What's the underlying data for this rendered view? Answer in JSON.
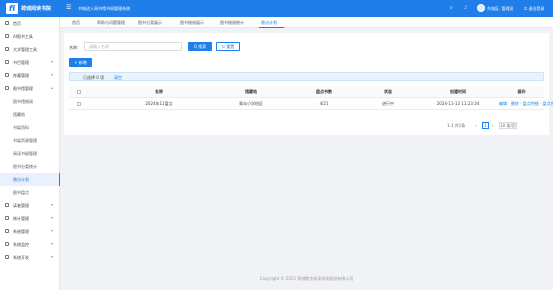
{
  "header": {
    "logo_text": "fi",
    "brand": "荷城阅读书院",
    "system_title": "书城进入网书馆书网管理系统",
    "username": "东城区. 管理员",
    "logout": "退出登录"
  },
  "tabs": [
    {
      "label": "首页"
    },
    {
      "label": "帮助与问题管理"
    },
    {
      "label": "图书分类展示"
    },
    {
      "label": "图书借阅展示"
    },
    {
      "label": "图书借阅统计"
    },
    {
      "label": "邀访计划"
    }
  ],
  "sidebar": {
    "items": [
      {
        "label": "首页",
        "icon": "home-icon"
      },
      {
        "label": "AI图书工具",
        "icon": "ai-icon"
      },
      {
        "label": "大学管理工具",
        "icon": "school-icon"
      },
      {
        "label": "书目管理",
        "icon": "book-icon",
        "chevron": "▾"
      },
      {
        "label": "库藏管理",
        "icon": "storage-icon",
        "chevron": "▾"
      },
      {
        "label": "图书馆管理",
        "icon": "library-icon",
        "chevron": "▴"
      },
      {
        "label": "图书馆借阅"
      },
      {
        "label": "馆藏地"
      },
      {
        "label": "书架资料"
      },
      {
        "label": "书架资源管理"
      },
      {
        "label": "阅读书册管理"
      },
      {
        "label": "图书分类统计"
      },
      {
        "label": "邀访计划"
      },
      {
        "label": "图书盘点"
      },
      {
        "label": "读者管理",
        "icon": "user-icon",
        "chevron": "▾"
      },
      {
        "label": "统计管理",
        "icon": "stats-icon",
        "chevron": "▾"
      },
      {
        "label": "系统管理",
        "icon": "settings-icon",
        "chevron": "▾"
      },
      {
        "label": "系统监控",
        "icon": "monitor-icon",
        "chevron": "▾"
      },
      {
        "label": "系统开发",
        "icon": "dev-icon",
        "chevron": "▾"
      }
    ]
  },
  "query": {
    "label": "名称:",
    "placeholder": "请输入名称"
  },
  "buttons": {
    "search": "Q 搜索",
    "reset": "↻ 重置",
    "add": "+ 新增"
  },
  "selection": {
    "text": "已选择 0 项",
    "clear": "清空"
  },
  "table": {
    "columns": [
      "名称",
      "馆藏地",
      "盘点书数",
      "状态",
      "创建时间",
      "操作"
    ],
    "rows": [
      {
        "name": "2024年11盘点",
        "org": "青岛小学校区",
        "count": "4/21",
        "status": "进行中",
        "created": "2024-11-12 11:23:34",
        "ops": "编辑 · 删除 · 盘点明细 · 盘点完成"
      }
    ]
  },
  "pagination": {
    "range": "1-1 共1条",
    "prev": "‹",
    "page": "1",
    "next": "›",
    "page_size": "10 条/页"
  },
  "footer": "Copyright © 2022 荷城数字阅读科技股份有限公司"
}
